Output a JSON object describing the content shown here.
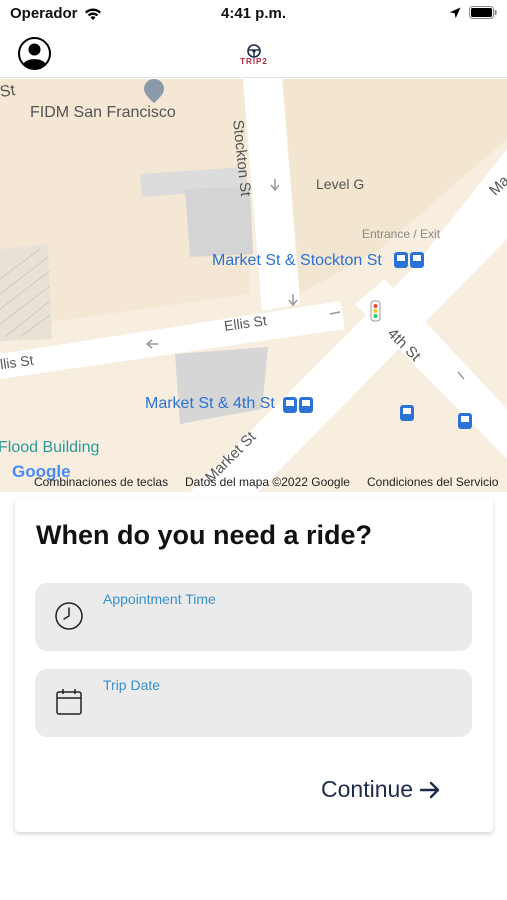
{
  "status_bar": {
    "carrier": "Operador",
    "time": "4:41 p.m.",
    "icons": [
      "wifi-icon",
      "location-arrow-icon",
      "battery-icon"
    ]
  },
  "header": {
    "logo_text": "TRIP2",
    "brand_color": "#b0283a"
  },
  "map": {
    "labels": {
      "fidm": "FIDM San Francisco",
      "stockton_st": "Stockton St",
      "level_g": "Level G",
      "entrance_exit": "Entrance / Exit",
      "market_stockton": "Market St & Stockton St",
      "ellis_st_1": "Ellis St",
      "ellis_st_2": "llis St",
      "fourth_st": "4th St",
      "market_4th": "Market St & 4th St",
      "flood_building": "Flood Building",
      "market_st_diag": "Market St",
      "top_left_st": "St",
      "ma": "Ma"
    },
    "footer": {
      "shortcuts": "Combinaciones de teclas",
      "map_data": "Datos del mapa ©2022 Google",
      "terms": "Condiciones del Servicio"
    },
    "google_logo": "Google"
  },
  "card": {
    "title": "When do you need a ride?",
    "appointment_label": "Appointment Time",
    "appointment_value": "",
    "trip_date_label": "Trip Date",
    "trip_date_value": "",
    "continue_label": "Continue",
    "accent_color": "#3a8fcc"
  }
}
